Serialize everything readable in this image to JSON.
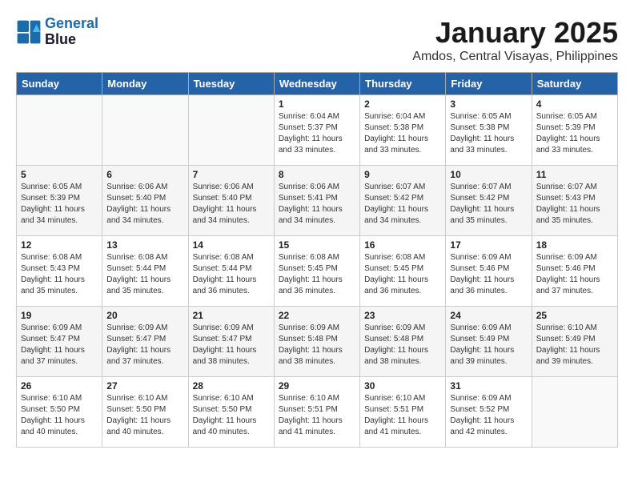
{
  "header": {
    "logo_line1": "General",
    "logo_line2": "Blue",
    "title": "January 2025",
    "subtitle": "Amdos, Central Visayas, Philippines"
  },
  "weekdays": [
    "Sunday",
    "Monday",
    "Tuesday",
    "Wednesday",
    "Thursday",
    "Friday",
    "Saturday"
  ],
  "weeks": [
    [
      {
        "day": "",
        "info": ""
      },
      {
        "day": "",
        "info": ""
      },
      {
        "day": "",
        "info": ""
      },
      {
        "day": "1",
        "info": "Sunrise: 6:04 AM\nSunset: 5:37 PM\nDaylight: 11 hours\nand 33 minutes."
      },
      {
        "day": "2",
        "info": "Sunrise: 6:04 AM\nSunset: 5:38 PM\nDaylight: 11 hours\nand 33 minutes."
      },
      {
        "day": "3",
        "info": "Sunrise: 6:05 AM\nSunset: 5:38 PM\nDaylight: 11 hours\nand 33 minutes."
      },
      {
        "day": "4",
        "info": "Sunrise: 6:05 AM\nSunset: 5:39 PM\nDaylight: 11 hours\nand 33 minutes."
      }
    ],
    [
      {
        "day": "5",
        "info": "Sunrise: 6:05 AM\nSunset: 5:39 PM\nDaylight: 11 hours\nand 34 minutes."
      },
      {
        "day": "6",
        "info": "Sunrise: 6:06 AM\nSunset: 5:40 PM\nDaylight: 11 hours\nand 34 minutes."
      },
      {
        "day": "7",
        "info": "Sunrise: 6:06 AM\nSunset: 5:40 PM\nDaylight: 11 hours\nand 34 minutes."
      },
      {
        "day": "8",
        "info": "Sunrise: 6:06 AM\nSunset: 5:41 PM\nDaylight: 11 hours\nand 34 minutes."
      },
      {
        "day": "9",
        "info": "Sunrise: 6:07 AM\nSunset: 5:42 PM\nDaylight: 11 hours\nand 34 minutes."
      },
      {
        "day": "10",
        "info": "Sunrise: 6:07 AM\nSunset: 5:42 PM\nDaylight: 11 hours\nand 35 minutes."
      },
      {
        "day": "11",
        "info": "Sunrise: 6:07 AM\nSunset: 5:43 PM\nDaylight: 11 hours\nand 35 minutes."
      }
    ],
    [
      {
        "day": "12",
        "info": "Sunrise: 6:08 AM\nSunset: 5:43 PM\nDaylight: 11 hours\nand 35 minutes."
      },
      {
        "day": "13",
        "info": "Sunrise: 6:08 AM\nSunset: 5:44 PM\nDaylight: 11 hours\nand 35 minutes."
      },
      {
        "day": "14",
        "info": "Sunrise: 6:08 AM\nSunset: 5:44 PM\nDaylight: 11 hours\nand 36 minutes."
      },
      {
        "day": "15",
        "info": "Sunrise: 6:08 AM\nSunset: 5:45 PM\nDaylight: 11 hours\nand 36 minutes."
      },
      {
        "day": "16",
        "info": "Sunrise: 6:08 AM\nSunset: 5:45 PM\nDaylight: 11 hours\nand 36 minutes."
      },
      {
        "day": "17",
        "info": "Sunrise: 6:09 AM\nSunset: 5:46 PM\nDaylight: 11 hours\nand 36 minutes."
      },
      {
        "day": "18",
        "info": "Sunrise: 6:09 AM\nSunset: 5:46 PM\nDaylight: 11 hours\nand 37 minutes."
      }
    ],
    [
      {
        "day": "19",
        "info": "Sunrise: 6:09 AM\nSunset: 5:47 PM\nDaylight: 11 hours\nand 37 minutes."
      },
      {
        "day": "20",
        "info": "Sunrise: 6:09 AM\nSunset: 5:47 PM\nDaylight: 11 hours\nand 37 minutes."
      },
      {
        "day": "21",
        "info": "Sunrise: 6:09 AM\nSunset: 5:47 PM\nDaylight: 11 hours\nand 38 minutes."
      },
      {
        "day": "22",
        "info": "Sunrise: 6:09 AM\nSunset: 5:48 PM\nDaylight: 11 hours\nand 38 minutes."
      },
      {
        "day": "23",
        "info": "Sunrise: 6:09 AM\nSunset: 5:48 PM\nDaylight: 11 hours\nand 38 minutes."
      },
      {
        "day": "24",
        "info": "Sunrise: 6:09 AM\nSunset: 5:49 PM\nDaylight: 11 hours\nand 39 minutes."
      },
      {
        "day": "25",
        "info": "Sunrise: 6:10 AM\nSunset: 5:49 PM\nDaylight: 11 hours\nand 39 minutes."
      }
    ],
    [
      {
        "day": "26",
        "info": "Sunrise: 6:10 AM\nSunset: 5:50 PM\nDaylight: 11 hours\nand 40 minutes."
      },
      {
        "day": "27",
        "info": "Sunrise: 6:10 AM\nSunset: 5:50 PM\nDaylight: 11 hours\nand 40 minutes."
      },
      {
        "day": "28",
        "info": "Sunrise: 6:10 AM\nSunset: 5:50 PM\nDaylight: 11 hours\nand 40 minutes."
      },
      {
        "day": "29",
        "info": "Sunrise: 6:10 AM\nSunset: 5:51 PM\nDaylight: 11 hours\nand 41 minutes."
      },
      {
        "day": "30",
        "info": "Sunrise: 6:10 AM\nSunset: 5:51 PM\nDaylight: 11 hours\nand 41 minutes."
      },
      {
        "day": "31",
        "info": "Sunrise: 6:09 AM\nSunset: 5:52 PM\nDaylight: 11 hours\nand 42 minutes."
      },
      {
        "day": "",
        "info": ""
      }
    ]
  ]
}
